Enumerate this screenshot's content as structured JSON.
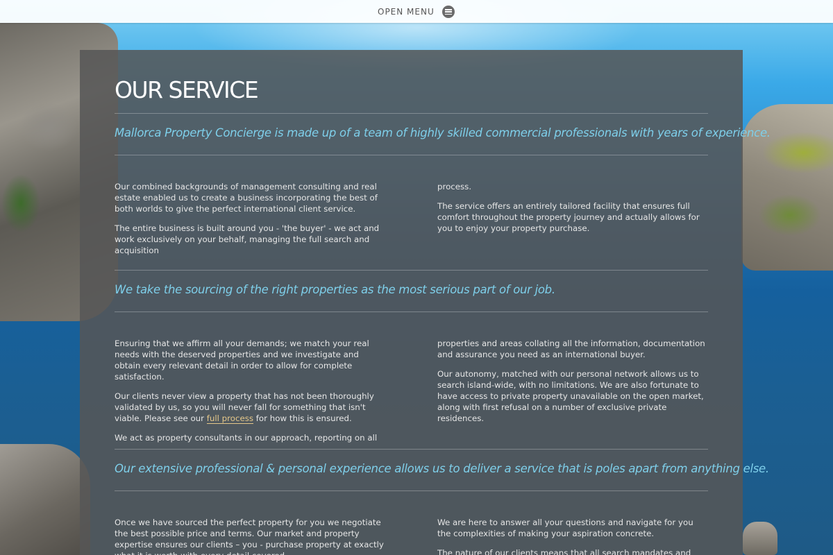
{
  "menu": {
    "label": "OPEN MENU",
    "icon": "hamburger-menu-icon"
  },
  "page_title": "OUR SERVICE",
  "sections": [
    {
      "tagline": "Mallorca Property Concierge is made up of a team of highly skilled commercial professionals with years of experience.",
      "left": [
        "Our combined backgrounds of management consulting and real estate enabled us to create a business incorporating the best of both worlds to give the perfect international client service.",
        "The entire business is built around you - 'the buyer' - we act and work exclusively on your behalf, managing the full search and acquisition"
      ],
      "right": [
        "process.",
        "The service offers an entirely tailored facility that ensures full comfort throughout the property journey and actually allows for you to enjoy your property purchase."
      ]
    },
    {
      "tagline": "We take the sourcing of the right properties as the most serious part of our job.",
      "left": [
        "Ensuring that we affirm all your demands; we match your real needs with the deserved properties and we investigate and obtain every relevant detail in order to allow for complete satisfaction.",
        "We act as property consultants in our approach, reporting on all"
      ],
      "left_link_paragraph": {
        "before": "Our clients never view a property that has not been thoroughly validated by us, so you will never fall for something that isn't viable. Please see our ",
        "link": "full process",
        "after": " for how this is ensured."
      },
      "right": [
        "properties and areas collating all the information, documentation and assurance you need as an international buyer.",
        "Our autonomy, matched with our personal network allows us to search island-wide, with no limitations. We are also fortunate to have access to private property unavailable on the open market, along with first refusal on a number of exclusive private residences."
      ]
    },
    {
      "tagline": "Our extensive professional & personal experience allows us to deliver a service that is poles apart from anything else.",
      "left": [
        "Once we have sourced the perfect property for you we negotiate the best possible price and terms. Our market and property expertise ensures our clients – you - purchase property at exactly what it is worth with every detail covered."
      ],
      "right": [
        "We are here to answer all your questions and navigate for you the complexities of making your aspiration concrete.",
        "The nature of our clients means that all search mandates and"
      ]
    }
  ]
}
